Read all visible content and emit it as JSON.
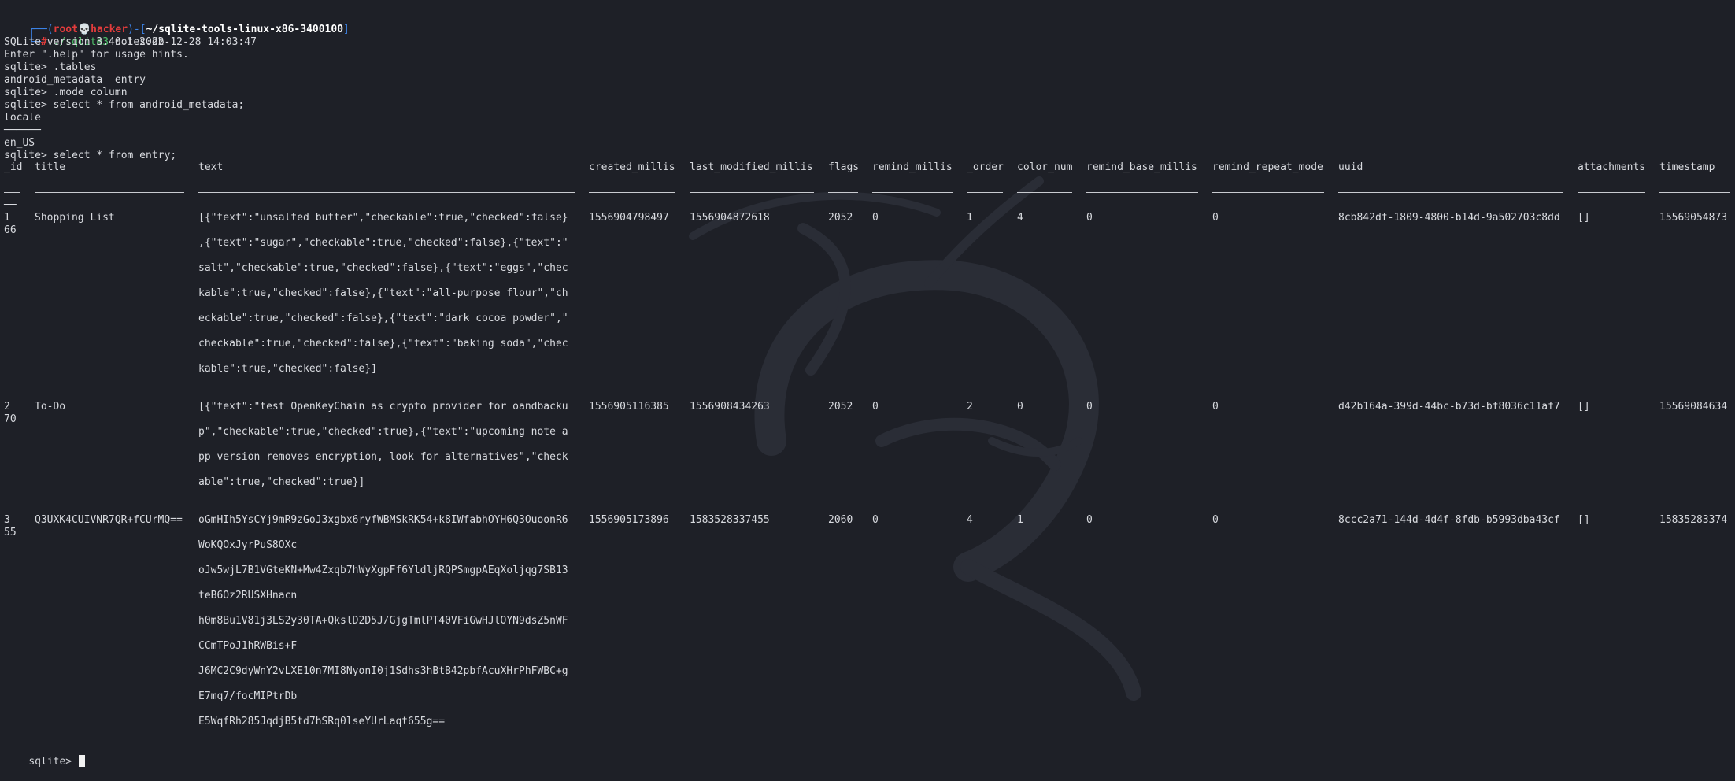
{
  "prompt": {
    "user": "root",
    "skull": "💀",
    "host": "hacker",
    "cwd": "~/sqlite-tools-linux-x86-3400100",
    "cmd": "./sqlite3",
    "arg": "notes.db"
  },
  "lines": {
    "version": "SQLite version 3.40.1 2022-12-28 14:03:47",
    "help": "Enter \".help\" for usage hints.",
    "cmd_tables": "sqlite> .tables",
    "tables": "android_metadata  entry",
    "cmd_mode": "sqlite> .mode column",
    "cmd_meta": "sqlite> select * from android_metadata;",
    "meta_header": "locale",
    "meta_rule": "──────",
    "meta_value": "en_US",
    "cmd_entry": "sqlite> select * from entry;",
    "final_prompt": "sqlite> "
  },
  "table": {
    "columns": [
      "_id",
      "title",
      "text",
      "created_millis",
      "last_modified_millis",
      "flags",
      "remind_millis",
      "_order",
      "color_num",
      "remind_base_millis",
      "remind_repeat_mode",
      "uuid",
      "attachments",
      "timestamp"
    ],
    "id_rule_cont": "──",
    "rows": [
      {
        "id": "1",
        "title": "Shopping List",
        "text": [
          "[{\"text\":\"unsalted butter\",\"checkable\":true,\"checked\":false}",
          ",{\"text\":\"sugar\",\"checkable\":true,\"checked\":false},{\"text\":\"",
          "salt\",\"checkable\":true,\"checked\":false},{\"text\":\"eggs\",\"chec",
          "kable\":true,\"checked\":false},{\"text\":\"all-purpose flour\",\"ch",
          "eckable\":true,\"checked\":false},{\"text\":\"dark cocoa powder\",\"",
          "checkable\":true,\"checked\":false},{\"text\":\"baking soda\",\"chec",
          "kable\":true,\"checked\":false}]"
        ],
        "created_millis": "1556904798497",
        "last_modified_millis": "1556904872618",
        "flags": "2052",
        "remind_millis": "0",
        "order": "1",
        "color_num": "4",
        "remind_base_millis": "0",
        "remind_repeat_mode": "0",
        "uuid": "8cb842df-1809-4800-b14d-9a502703c8dd",
        "attachments": "[]",
        "timestamp": "15569054873",
        "id_cont": "66"
      },
      {
        "id": "2",
        "title": "To-Do",
        "text": [
          "[{\"text\":\"test OpenKeyChain as crypto provider for oandbacku",
          "p\",\"checkable\":true,\"checked\":true},{\"text\":\"upcoming note a",
          "pp version removes encryption, look for alternatives\",\"check",
          "able\":true,\"checked\":true}]"
        ],
        "created_millis": "1556905116385",
        "last_modified_millis": "1556908434263",
        "flags": "2052",
        "remind_millis": "0",
        "order": "2",
        "color_num": "0",
        "remind_base_millis": "0",
        "remind_repeat_mode": "0",
        "uuid": "d42b164a-399d-44bc-b73d-bf8036c11af7",
        "attachments": "[]",
        "timestamp": "15569084634",
        "id_cont": "70"
      },
      {
        "id": "3",
        "title": "Q3UXK4CUIVNR7QR+fCUrMQ==",
        "text": [
          "oGmHIh5YsCYj9mR9zGoJ3xgbx6ryfWBMSkRK54+k8IWfabhOYH6Q3OuoonR6",
          "WoKQOxJyrPuS8OXc",
          "oJw5wjL7B1VGteKN+Mw4Zxqb7hWyXgpFf6YldljRQPSmgpAEqXoljqg7SB13",
          "teB6Oz2RUSXHnacn",
          "h0m8Bu1V81j3LS2y30TA+QkslD2D5J/GjgTmlPT40VFiGwHJlOYN9dsZ5nWF",
          "CCmTPoJ1hRWBis+F",
          "J6MC2C9dyWnY2vLXE10n7MI8NyonI0j1Sdhs3hBtB42pbfAcuXHrPhFWBC+g",
          "E7mq7/focMIPtrDb",
          "E5WqfRh285JqdjB5td7hSRq0lseYUrLaqt655g=="
        ],
        "created_millis": "1556905173896",
        "last_modified_millis": "1583528337455",
        "flags": "2060",
        "remind_millis": "0",
        "order": "4",
        "color_num": "1",
        "remind_base_millis": "0",
        "remind_repeat_mode": "0",
        "uuid": "8ccc2a71-144d-4d4f-8fdb-b5993dba43cf",
        "attachments": "[]",
        "timestamp": "15835283374",
        "id_cont": "55"
      }
    ]
  },
  "colors": {
    "background": "#1e2027",
    "text": "#d8dadf",
    "prompt_blue": "#3b82e6",
    "prompt_red": "#e23c3c"
  }
}
